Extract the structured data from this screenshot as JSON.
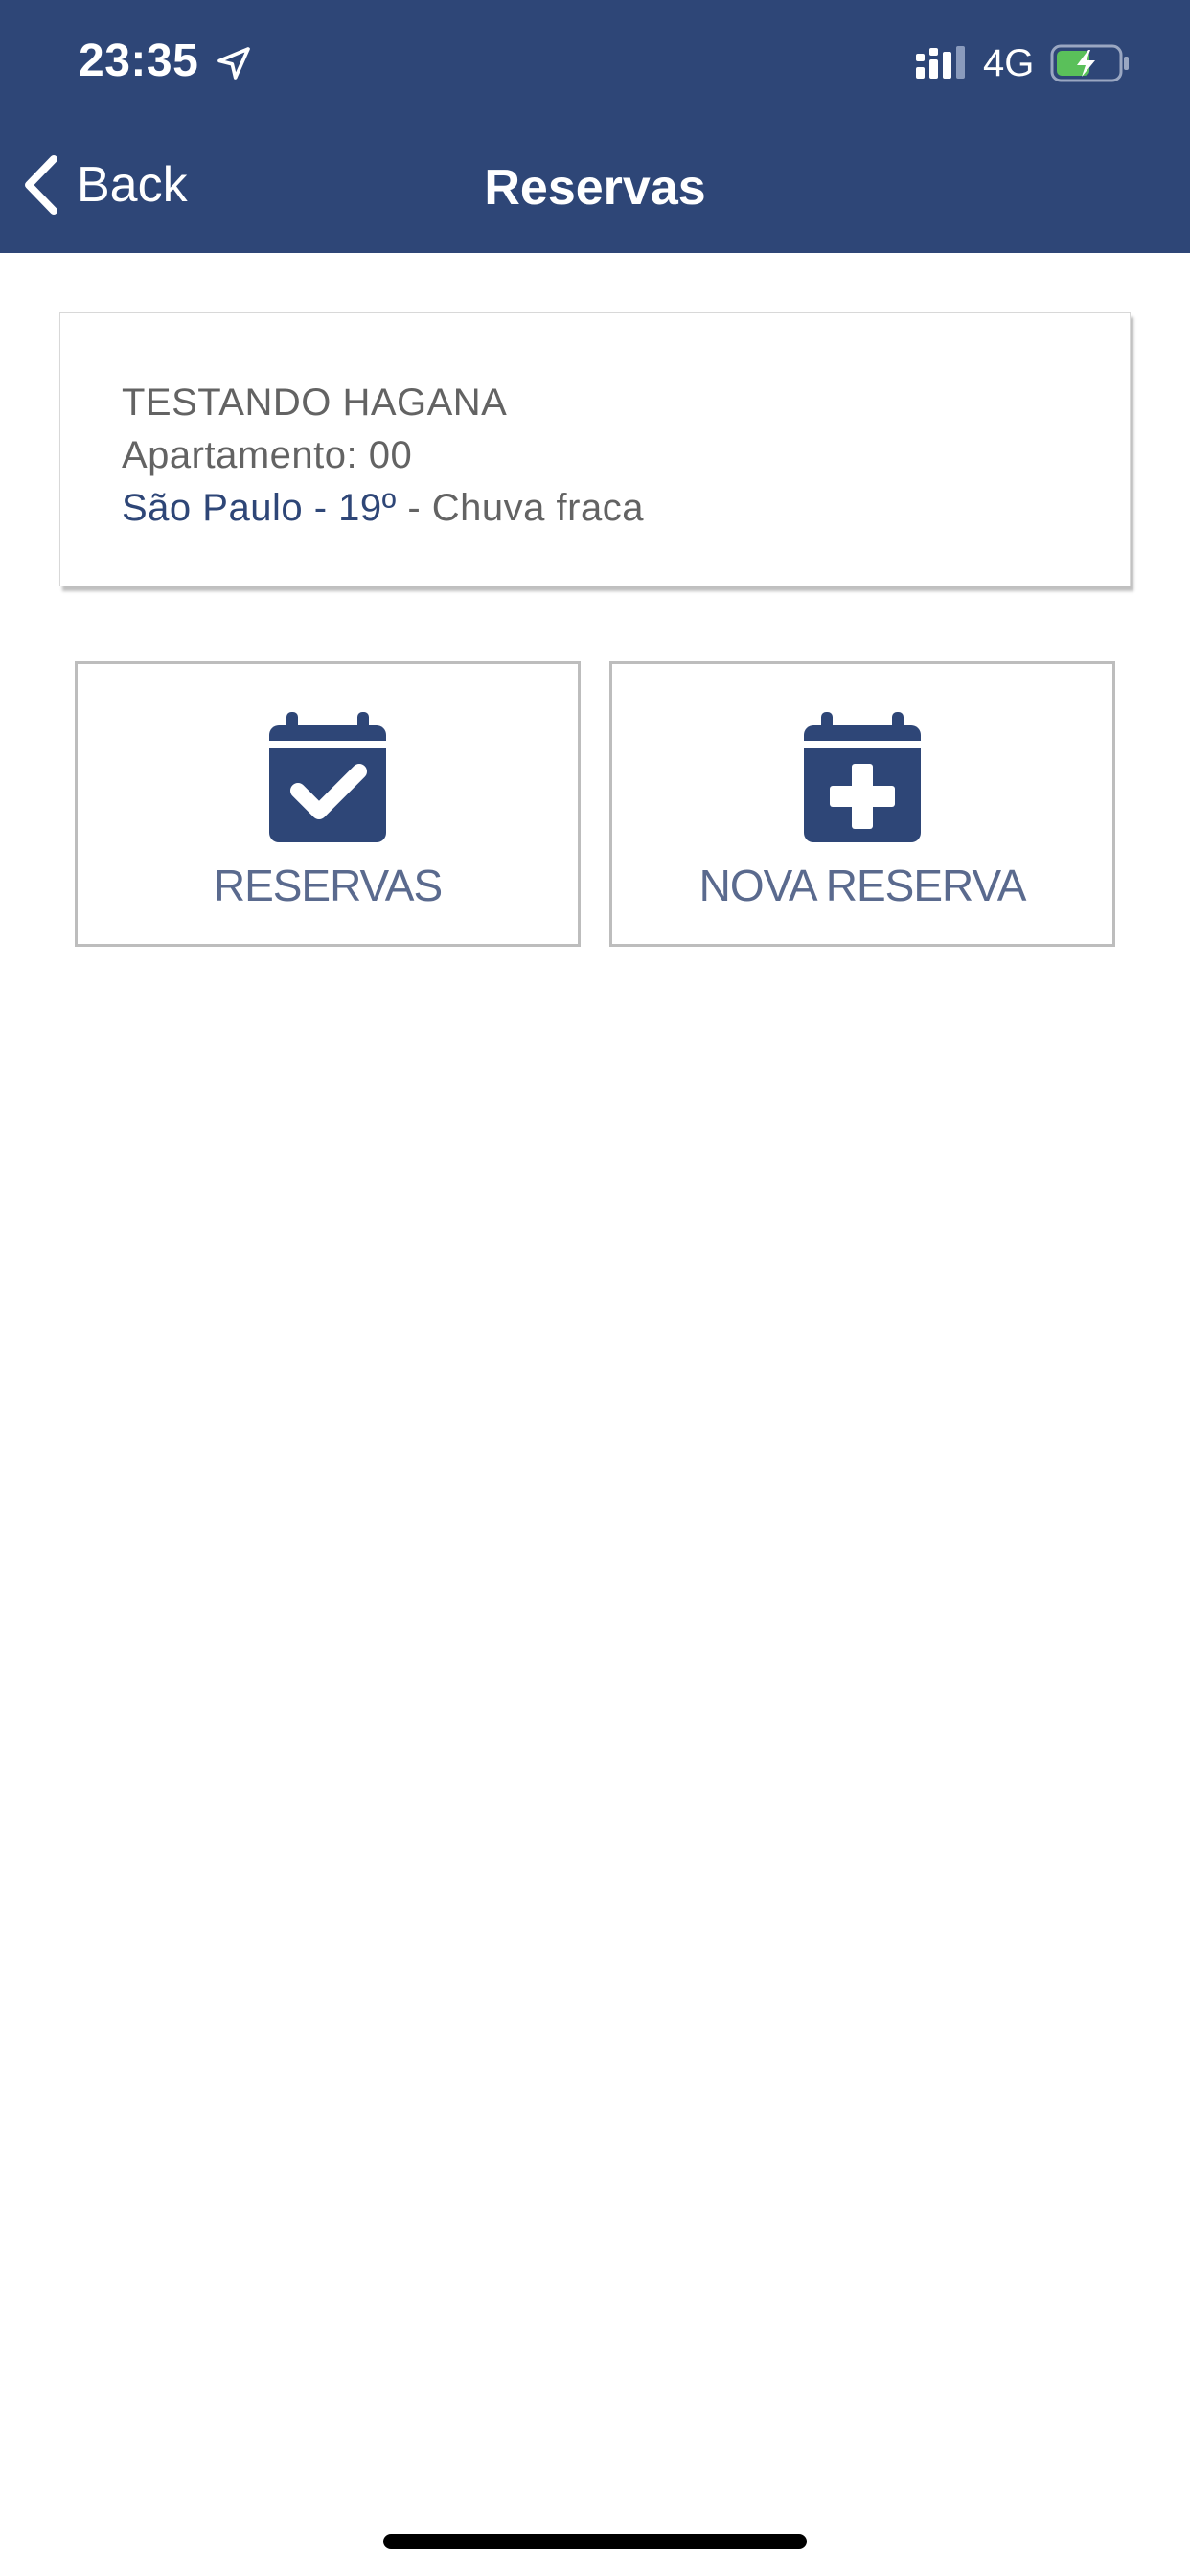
{
  "status_bar": {
    "time": "23:35",
    "network": "4G",
    "icons": [
      "location-arrow-icon",
      "signal-icon",
      "battery-charging-icon"
    ],
    "battery_color": "#5ac05a"
  },
  "nav": {
    "back_label": "Back",
    "title": "Reservas"
  },
  "info_card": {
    "name": "TESTANDO HAGANA",
    "apartment": "Apartamento: 00",
    "weather_city_temp": "São Paulo - 19º",
    "weather_condition": " - Chuva fraca"
  },
  "actions": [
    {
      "label": "RESERVAS",
      "icon": "calendar-check-icon"
    },
    {
      "label": "NOVA RESERVA",
      "icon": "calendar-plus-icon"
    }
  ],
  "colors": {
    "header_bg": "#2e4677",
    "accent": "#2e4677",
    "text_muted": "#636363",
    "tile_border": "#bdbdbd"
  }
}
